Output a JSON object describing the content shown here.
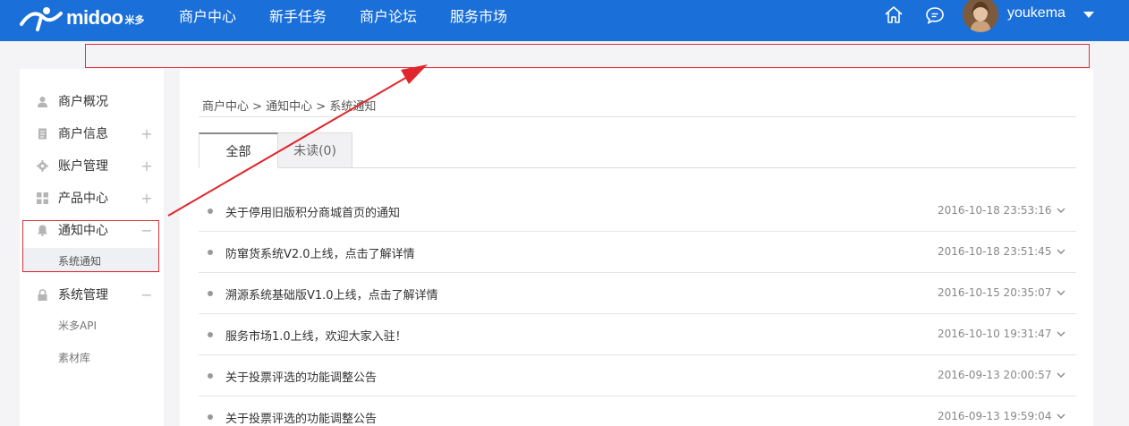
{
  "header": {
    "logo_text": "midoo",
    "logo_sub": "米多",
    "nav": [
      "商户中心",
      "新手任务",
      "商户论坛",
      "服务市场"
    ],
    "username": "youkema"
  },
  "sidebar": {
    "items": [
      {
        "label": "商户概况",
        "icon": "user-icon",
        "toggle": ""
      },
      {
        "label": "商户信息",
        "icon": "document-icon",
        "toggle": "+"
      },
      {
        "label": "账户管理",
        "icon": "gear-icon",
        "toggle": "+"
      },
      {
        "label": "产品中心",
        "icon": "grid-icon",
        "toggle": "+"
      },
      {
        "label": "通知中心",
        "icon": "bell-icon",
        "toggle": "−"
      },
      {
        "label": "系统管理",
        "icon": "lock-icon",
        "toggle": "−"
      }
    ],
    "notify_sub": [
      "系统通知"
    ],
    "system_sub": [
      "米多API",
      "素材库"
    ]
  },
  "main": {
    "breadcrumb": "商户中心 > 通知中心 > 系统通知",
    "tabs": [
      {
        "label": "全部"
      },
      {
        "label": "未读(0)"
      }
    ],
    "notices": [
      {
        "title": "关于停用旧版积分商城首页的通知",
        "time": "2016-10-18 23:53:16"
      },
      {
        "title": "防窜货系统V2.0上线，点击了解详情",
        "time": "2016-10-18 23:51:45"
      },
      {
        "title": "溯源系统基础版V1.0上线，点击了解详情",
        "time": "2016-10-15 20:35:07"
      },
      {
        "title": "服务市场1.0上线，欢迎大家入驻！",
        "time": "2016-10-10 19:31:47"
      },
      {
        "title": "关于投票评选的功能调整公告",
        "time": "2016-09-13 20:00:57"
      },
      {
        "title": "关于投票评选的功能调整公告",
        "time": "2016-09-13 19:59:04"
      }
    ]
  },
  "colors": {
    "header_bg": "#1a6fd8",
    "annotation_red": "#d9323a"
  }
}
